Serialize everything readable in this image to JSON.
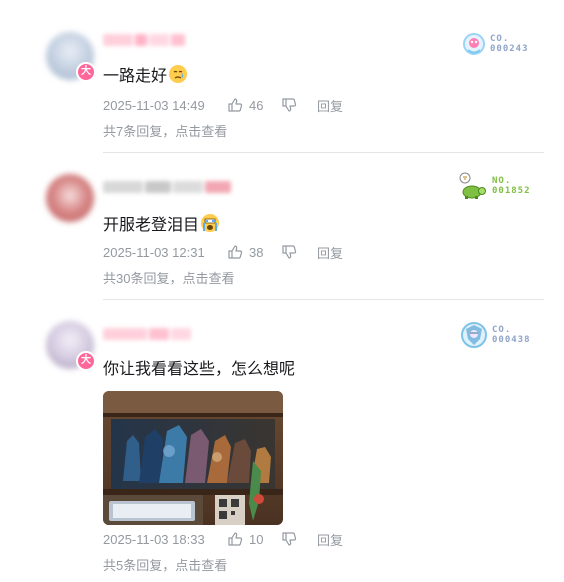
{
  "comments": [
    {
      "medal_prefix": "CO.",
      "medal_number": "000243",
      "text": "一路走好",
      "emoji": "crying-face-emoji",
      "time": "2025-11-03 14:49",
      "likes": "46",
      "reply_label": "回复",
      "replies_summary_prefix": "共7条回复，",
      "replies_action": "点击查看",
      "has_badge": true,
      "badge_text": "大",
      "medal_color": "#8fa4c8",
      "accent_color": "#ff6699"
    },
    {
      "medal_prefix": "NO.",
      "medal_number": "001852",
      "text": "开服老登泪目",
      "emoji": "sobbing-face-emoji",
      "time": "2025-11-03 12:31",
      "likes": "38",
      "reply_label": "回复",
      "replies_summary_prefix": "共30条回复，",
      "replies_action": "点击查看",
      "has_badge": false,
      "medal_color": "#7fc043"
    },
    {
      "medal_prefix": "CO.",
      "medal_number": "000438",
      "text": "你让我看看这些，怎么想呢",
      "emoji": "",
      "time": "2025-11-03 18:33",
      "likes": "10",
      "reply_label": "回复",
      "replies_summary_prefix": "共5条回复，",
      "replies_action": "点击查看",
      "has_badge": true,
      "badge_text": "大",
      "medal_color": "#8fa4c8",
      "image": "figure-collection-photo"
    }
  ]
}
